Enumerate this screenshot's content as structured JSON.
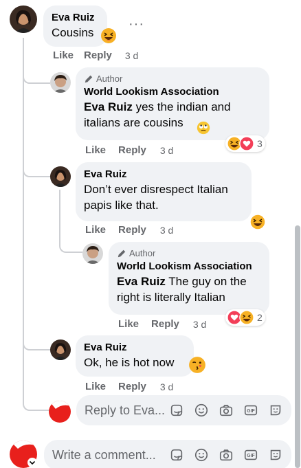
{
  "comments": [
    {
      "name": "Eva Ruiz",
      "text": "Cousins",
      "like": "Like",
      "reply": "Reply",
      "time": "3 d"
    },
    {
      "author_badge": "Author",
      "name": "World Lookism Association",
      "mention": "Eva Ruiz",
      "text": " yes the indian and italians are cousins",
      "like": "Like",
      "reply": "Reply",
      "time": "3 d",
      "reaction_count": "3"
    },
    {
      "name": "Eva Ruiz",
      "text": "Don’t ever disrespect Italian papis like that.",
      "like": "Like",
      "reply": "Reply",
      "time": "3 d"
    },
    {
      "author_badge": "Author",
      "name": "World Lookism Association",
      "mention": "Eva Ruiz",
      "text": " The guy on the right is literally Italian",
      "like": "Like",
      "reply": "Reply",
      "time": "3 d",
      "reaction_count": "2"
    },
    {
      "name": "Eva Ruiz",
      "text": "Ok, he is hot now",
      "like": "Like",
      "reply": "Reply",
      "time": "3 d"
    }
  ],
  "reply_box": {
    "placeholder": "Reply to Eva..."
  },
  "comment_box": {
    "placeholder": "Write a comment..."
  },
  "more_label": "···",
  "icons": [
    "sticker-icon",
    "emoji-icon",
    "camera-icon",
    "gif-icon",
    "avatar-sticker-icon"
  ],
  "colors": {
    "bubble": "#f0f2f5",
    "secondary_text": "#65676b",
    "thread_line": "#ced0d4",
    "love": "#f33e58",
    "haha": "#f7b125"
  }
}
